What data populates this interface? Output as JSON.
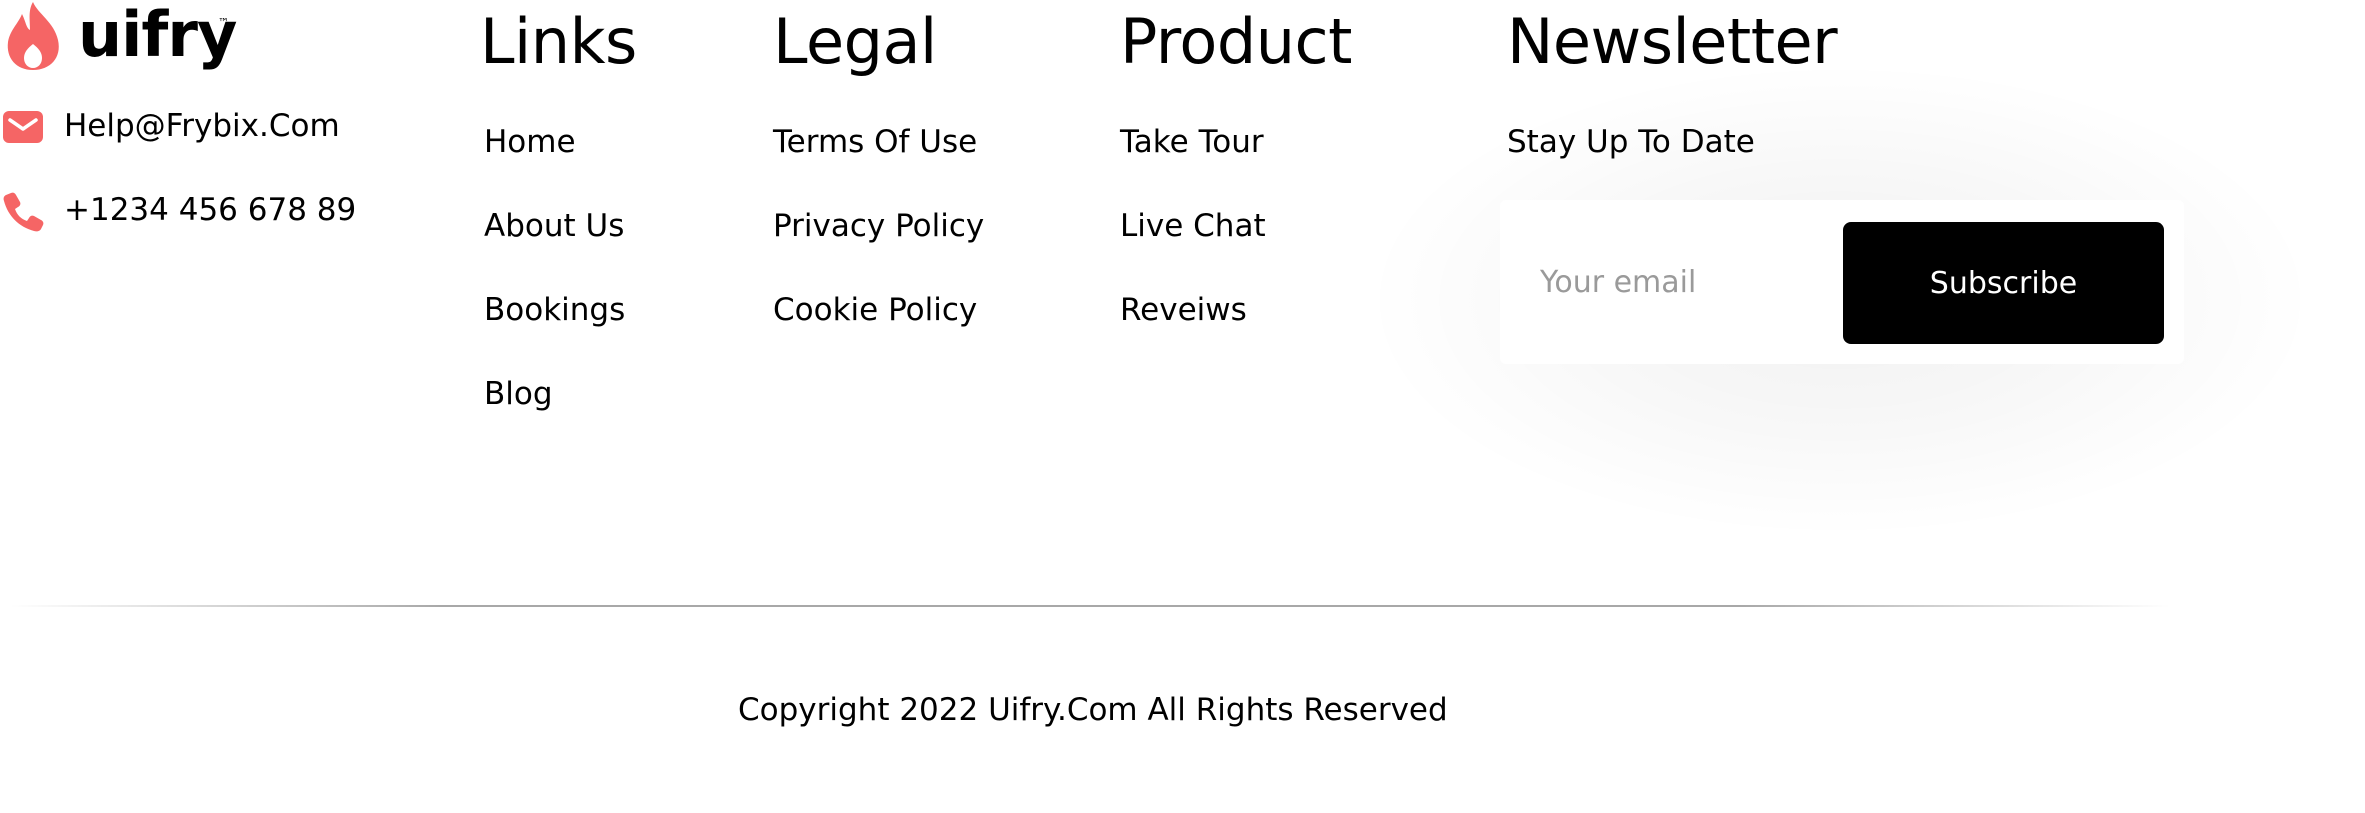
{
  "brand": {
    "name": "uifry",
    "trademark": "™",
    "accent_color": "#F56565",
    "logo_icon": "flame-icon"
  },
  "contact": {
    "email": "Help@Frybix.Com",
    "email_icon": "mail-icon",
    "phone": "+1234 456 678 89",
    "phone_icon": "phone-icon"
  },
  "columns": {
    "links": {
      "heading": "Links",
      "items": [
        "Home",
        "About Us",
        "Bookings",
        "Blog"
      ]
    },
    "legal": {
      "heading": "Legal",
      "items": [
        "Terms Of Use",
        "Privacy Policy",
        "Cookie Policy"
      ]
    },
    "product": {
      "heading": "Product",
      "items": [
        "Take Tour",
        "Live Chat",
        "Reveiws"
      ]
    }
  },
  "newsletter": {
    "heading": "Newsletter",
    "subtitle": "Stay Up To Date",
    "email_placeholder": "Your email",
    "button_label": "Subscribe"
  },
  "footer": {
    "copyright": "Copyright 2022 Uifry.Com All Rights Reserved"
  }
}
